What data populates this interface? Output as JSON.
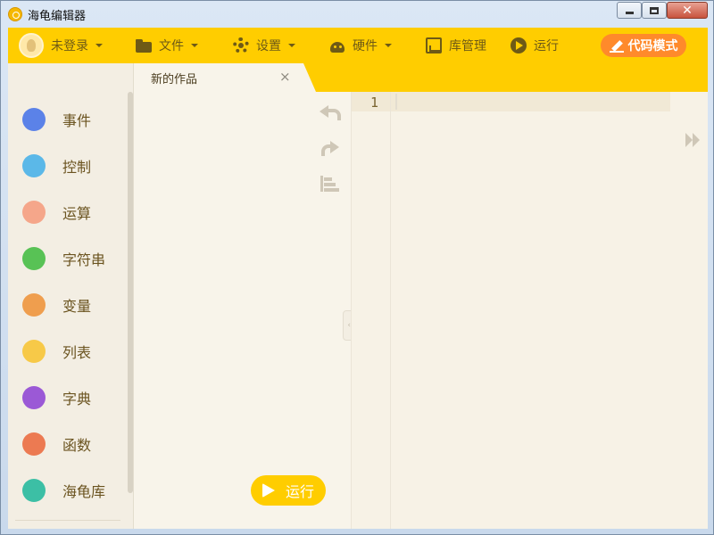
{
  "window": {
    "title": "海龟编辑器"
  },
  "toolbar": {
    "login": "未登录",
    "file": "文件",
    "settings": "设置",
    "hardware": "硬件",
    "library": "库管理",
    "run": "运行",
    "code_mode": "代码模式"
  },
  "tabs": [
    {
      "title": "新的作品",
      "close": "×"
    }
  ],
  "sidebar": {
    "items": [
      {
        "label": "事件",
        "icon": "toggle-icon",
        "color": "#5b82e8"
      },
      {
        "label": "控制",
        "icon": "gamepad-icon",
        "color": "#5bb8e8"
      },
      {
        "label": "运算",
        "icon": "calculator-icon",
        "color": "#f5a68a"
      },
      {
        "label": "字符串",
        "icon": "string-icon",
        "color": "#58c255"
      },
      {
        "label": "变量",
        "icon": "variable-x-icon",
        "color": "#ef9e4e"
      },
      {
        "label": "列表",
        "icon": "list-icon",
        "color": "#f7c948"
      },
      {
        "label": "字典",
        "icon": "book-icon",
        "color": "#9b59d6"
      },
      {
        "label": "函数",
        "icon": "code-icon",
        "color": "#ec7a52"
      },
      {
        "label": "海龟库",
        "icon": "turtle-icon",
        "color": "#3cbfa5"
      }
    ]
  },
  "workspace": {
    "run_button": "运行"
  },
  "editor": {
    "line_numbers": [
      "1"
    ]
  },
  "colors": {
    "toolbar": "#ffcd00",
    "accent_orange": "#ff8a2b",
    "background": "#f8f4ea"
  }
}
